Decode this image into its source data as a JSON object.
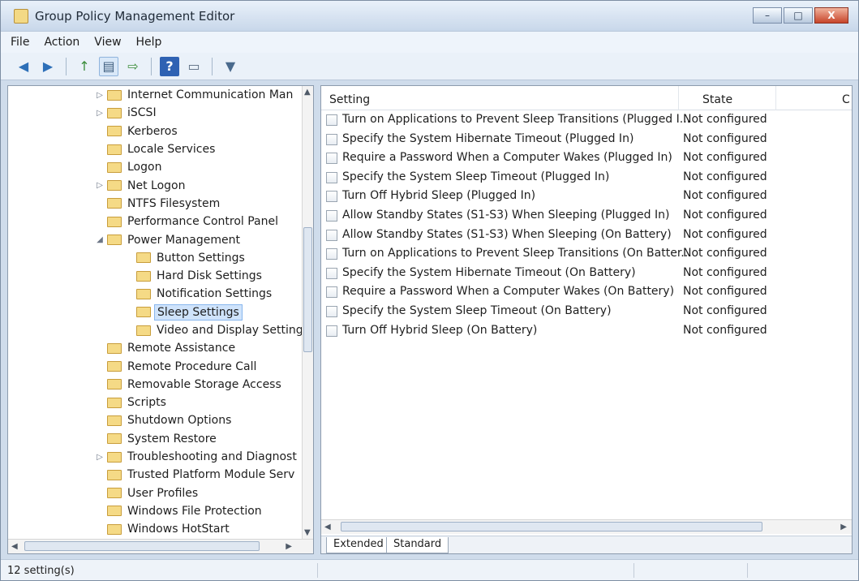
{
  "window": {
    "title": "Group Policy Management Editor"
  },
  "window_controls": {
    "minimize": "–",
    "maximize": "□",
    "close": "X"
  },
  "menu": [
    "File",
    "Action",
    "View",
    "Help"
  ],
  "toolbar": {
    "back": "◀",
    "forward": "▶",
    "up": "↑",
    "show_hide_tree": "▤",
    "export": "⇨",
    "help": "?",
    "properties": "▭",
    "filter": "▼"
  },
  "tree": [
    {
      "label": "Internet Communication Man",
      "expander": "▷",
      "indent": 0
    },
    {
      "label": "iSCSI",
      "expander": "▷",
      "indent": 0
    },
    {
      "label": "Kerberos",
      "expander": "",
      "indent": 0
    },
    {
      "label": "Locale Services",
      "expander": "",
      "indent": 0
    },
    {
      "label": "Logon",
      "expander": "",
      "indent": 0
    },
    {
      "label": "Net Logon",
      "expander": "▷",
      "indent": 0
    },
    {
      "label": "NTFS Filesystem",
      "expander": "",
      "indent": 0
    },
    {
      "label": "Performance Control Panel",
      "expander": "",
      "indent": 0
    },
    {
      "label": "Power Management",
      "expander": "◢",
      "indent": 0
    },
    {
      "label": "Button Settings",
      "expander": "",
      "indent": 1
    },
    {
      "label": "Hard Disk Settings",
      "expander": "",
      "indent": 1
    },
    {
      "label": "Notification Settings",
      "expander": "",
      "indent": 1
    },
    {
      "label": "Sleep Settings",
      "expander": "",
      "indent": 1,
      "selected": true
    },
    {
      "label": "Video and Display Settings",
      "expander": "",
      "indent": 1
    },
    {
      "label": "Remote Assistance",
      "expander": "",
      "indent": 0
    },
    {
      "label": "Remote Procedure Call",
      "expander": "",
      "indent": 0
    },
    {
      "label": "Removable Storage Access",
      "expander": "",
      "indent": 0
    },
    {
      "label": "Scripts",
      "expander": "",
      "indent": 0
    },
    {
      "label": "Shutdown Options",
      "expander": "",
      "indent": 0
    },
    {
      "label": "System Restore",
      "expander": "",
      "indent": 0
    },
    {
      "label": "Troubleshooting and Diagnost",
      "expander": "▷",
      "indent": 0
    },
    {
      "label": "Trusted Platform Module Serv",
      "expander": "",
      "indent": 0
    },
    {
      "label": "User Profiles",
      "expander": "",
      "indent": 0
    },
    {
      "label": "Windows File Protection",
      "expander": "",
      "indent": 0
    },
    {
      "label": "Windows HotStart",
      "expander": "",
      "indent": 0
    }
  ],
  "list": {
    "columns": {
      "setting": "Setting",
      "state": "State",
      "comment": "C"
    },
    "rows": [
      {
        "setting": "Turn on Applications to Prevent Sleep Transitions (Plugged I...",
        "state": "Not configured"
      },
      {
        "setting": "Specify the System Hibernate Timeout (Plugged In)",
        "state": "Not configured"
      },
      {
        "setting": "Require a Password When a Computer Wakes (Plugged In)",
        "state": "Not configured"
      },
      {
        "setting": "Specify the System Sleep Timeout (Plugged In)",
        "state": "Not configured"
      },
      {
        "setting": "Turn Off Hybrid Sleep (Plugged In)",
        "state": "Not configured"
      },
      {
        "setting": "Allow Standby States (S1-S3) When Sleeping (Plugged In)",
        "state": "Not configured"
      },
      {
        "setting": "Allow Standby States (S1-S3) When Sleeping (On Battery)",
        "state": "Not configured"
      },
      {
        "setting": "Turn on Applications to Prevent Sleep Transitions (On Batter...",
        "state": "Not configured"
      },
      {
        "setting": "Specify the System Hibernate Timeout (On Battery)",
        "state": "Not configured"
      },
      {
        "setting": "Require a Password When a Computer Wakes (On Battery)",
        "state": "Not configured"
      },
      {
        "setting": "Specify the System Sleep Timeout (On Battery)",
        "state": "Not configured"
      },
      {
        "setting": "Turn Off Hybrid Sleep (On Battery)",
        "state": "Not configured"
      }
    ]
  },
  "tabs": [
    "Extended",
    "Standard"
  ],
  "status": {
    "text": "12 setting(s)"
  }
}
